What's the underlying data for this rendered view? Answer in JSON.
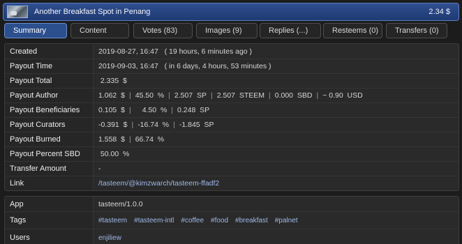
{
  "header": {
    "thumbnail_icon": "post-thumbnail",
    "title": "Another Breakfast Spot in Penang",
    "payout": "2.34 $"
  },
  "tabs": [
    {
      "label": "Summary",
      "active": true
    },
    {
      "label": "Content",
      "active": false
    },
    {
      "label": "Votes (83)",
      "active": false
    },
    {
      "label": "Images (9)",
      "active": false
    },
    {
      "label": "Replies (...)",
      "active": false
    },
    {
      "label": "Resteems (0)",
      "active": false
    },
    {
      "label": "Transfers (0)",
      "active": false
    }
  ],
  "summary": {
    "created": {
      "label": "Created",
      "value": "2019-08-27, 16:47   ( 19 hours, 6 minutes ago )"
    },
    "payout_time": {
      "label": "Payout Time",
      "value": "2019-09-03, 16:47   ( in 6 days, 4 hours, 53 minutes )"
    },
    "payout_total": {
      "label": "Payout Total",
      "value": " 2.335  $"
    },
    "payout_author": {
      "label": "Payout Author",
      "parts": [
        "1.062  $",
        "45.50  %",
        "2.507  SP",
        "2.507  STEEM",
        "0.000  SBD",
        "~ 0.90  USD"
      ]
    },
    "payout_beneficiaries": {
      "label": "Payout Beneficiaries",
      "parts": [
        "0.105  $",
        "4.50  %",
        "0.248  SP"
      ]
    },
    "payout_curators": {
      "label": "Payout Curators",
      "parts": [
        "-0.391  $",
        "-16.74  %",
        "-1.845  SP"
      ]
    },
    "payout_burned": {
      "label": "Payout Burned",
      "parts": [
        "1.558  $",
        "66.74  %"
      ]
    },
    "payout_percent_sbd": {
      "label": "Payout Percent SBD",
      "value": " 50.00  %"
    },
    "transfer_amount": {
      "label": "Transfer Amount",
      "value": "-"
    },
    "link": {
      "label": "Link",
      "value": "/tasteem/@kimzwarch/tasteem-ffadf2"
    }
  },
  "meta": {
    "app": {
      "label": "App",
      "value": "tasteem/1.0.0"
    },
    "tags": {
      "label": "Tags",
      "items": [
        "#tasteem",
        "#tasteem-intl",
        "#coffee",
        "#food",
        "#breakfast",
        "#palnet"
      ]
    },
    "users": {
      "label": "Users",
      "items": [
        "enjiliew"
      ]
    }
  },
  "colors": {
    "accent": "#2c4f8d",
    "link": "#9fb8e8",
    "background": "#1c1c1c",
    "panel": "#2a2a2a"
  }
}
